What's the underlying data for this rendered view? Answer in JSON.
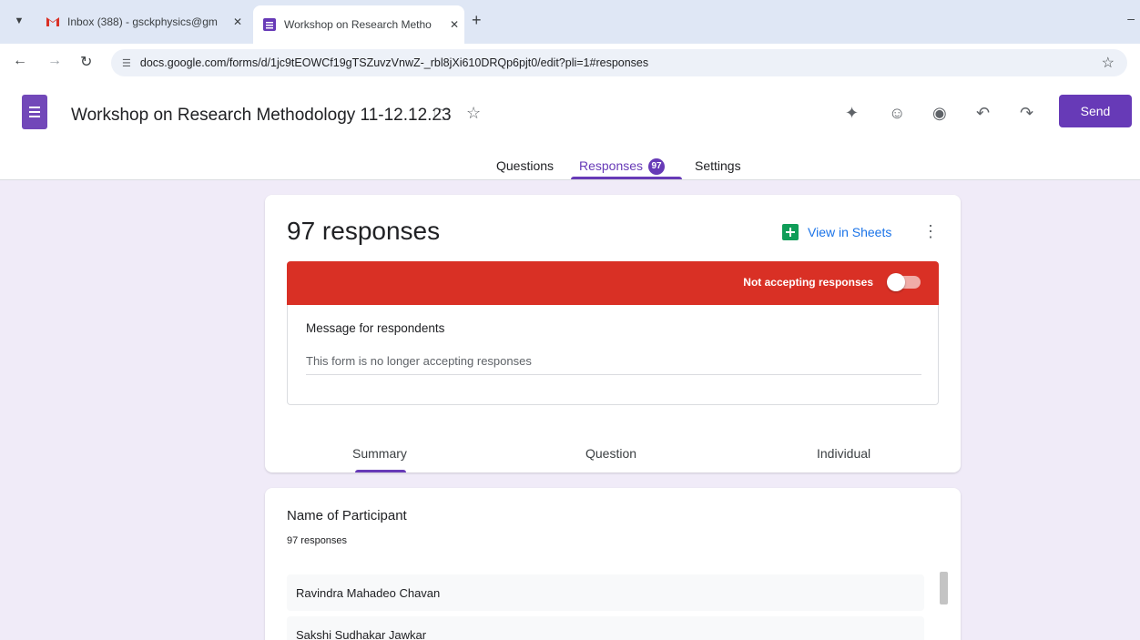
{
  "browser": {
    "tabs": [
      {
        "title": "Inbox (388) - gsckphysics@gm",
        "favicon": "gmail-icon"
      },
      {
        "title": "Workshop on Research Metho",
        "favicon": "forms-icon",
        "active": true
      }
    ],
    "url": "docs.google.com/forms/d/1jc9tEOWCf19gTSZuvzVnwZ-_rbl8jXi610DRQp6pjt0/edit?pli=1#responses"
  },
  "form": {
    "title": "Workshop on Research Methodology 11-12.12.23",
    "send_label": "Send",
    "tabs": {
      "questions": "Questions",
      "responses": "Responses",
      "responses_badge": "97",
      "settings": "Settings"
    }
  },
  "summary": {
    "count_label": "97 responses",
    "view_in_sheets": "View in Sheets",
    "not_accepting": "Not accepting responses",
    "accepting": false,
    "message_label": "Message for respondents",
    "message_value": "This form is no longer accepting responses",
    "subtabs": {
      "summary": "Summary",
      "question": "Question",
      "individual": "Individual"
    }
  },
  "question_card": {
    "title": "Name of Participant",
    "count": "97 responses",
    "answers": [
      "Ravindra Mahadeo Chavan",
      "Sakshi Sudhakar Jawkar"
    ]
  },
  "colors": {
    "accent": "#673ab7",
    "closed_banner": "#d93025",
    "canvas": "#f0ebf8",
    "sheets": "#0f9d58"
  }
}
